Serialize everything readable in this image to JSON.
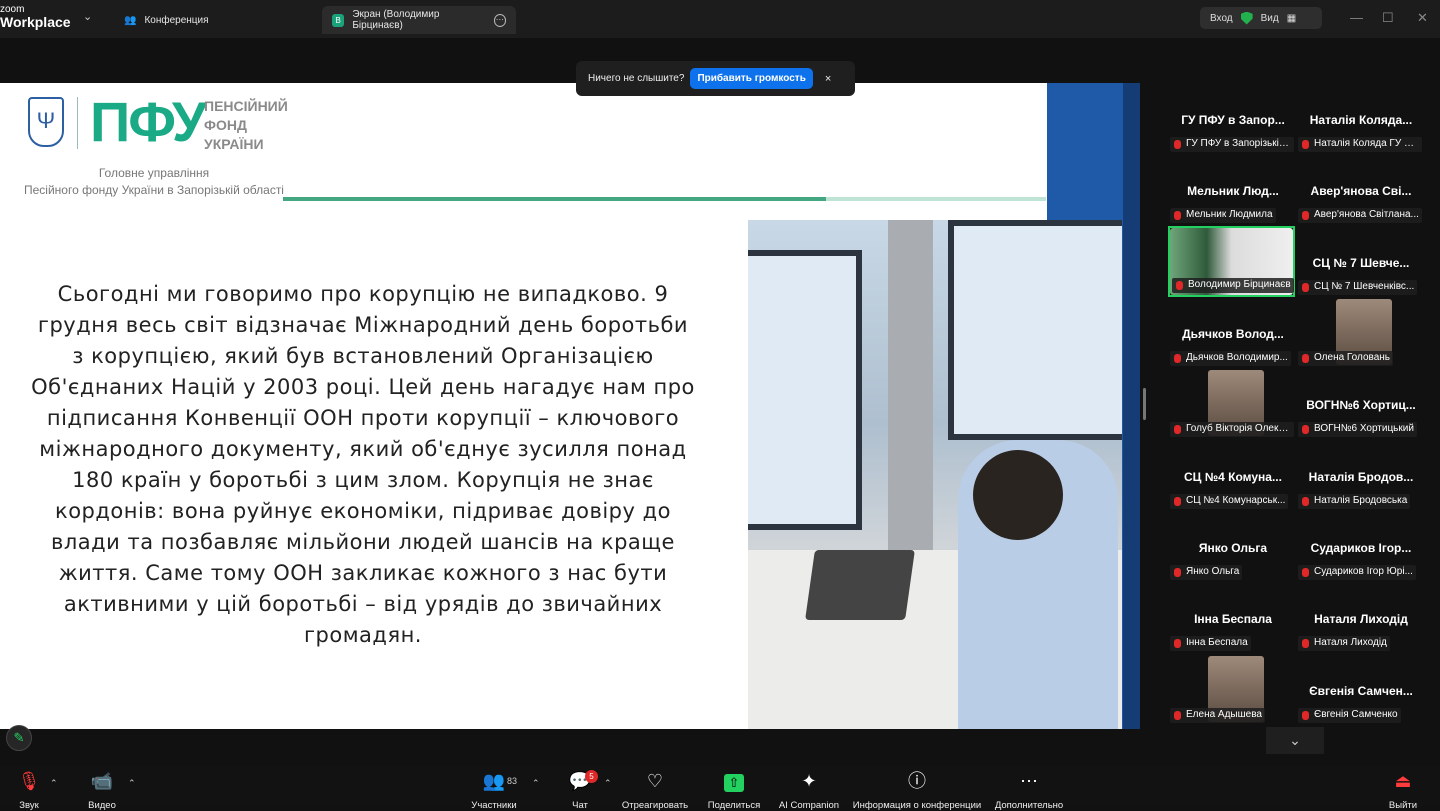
{
  "app": {
    "logo_top": "zoom",
    "logo_bottom": "Workplace"
  },
  "tabs": [
    {
      "label": "Конференция",
      "icon": "people-icon"
    },
    {
      "label": "Экран (Володимир Бірцинаєв)",
      "icon": "screen-icon",
      "avatar_letter": "В"
    }
  ],
  "header": {
    "signin_label": "Вход",
    "view_label": "Вид"
  },
  "notice": {
    "text": "Ничего не слышите?",
    "button_label": "Прибавить громкость",
    "close": "×"
  },
  "slide": {
    "emblem": "Ψ",
    "logo_text": "ПФУ",
    "logo_side": [
      "ПЕНСІЙНИЙ",
      "ФОНД",
      "УКРАЇНИ"
    ],
    "org": [
      "Головне управління",
      "Пеcійного фонду України в Запорізькій області"
    ],
    "body": "Сьогодні ми говоримо про корупцію не випадково. 9 грудня весь світ відзначає Міжнародний день боротьби з корупцією, який був встановлений Організацією Об'єднаних Націй у 2003 році. Цей день нагадує нам про підписання Конвенції ООН проти корупції – ключового міжнародного документу, який об'єднує зусилля понад 180 країн у боротьбі з цим злом. Корупція не знає кордонів: вона руйнує економіки, підриває довіру до влади та позбавляє мільйони людей шансів на краще життя. Саме тому ООН закликає кожного з нас бути активними у цій боротьбі – від урядів до звичайних громадян."
  },
  "participants": [
    {
      "name": "ГУ ПФУ в Запор...",
      "label": "ГУ ПФУ в Запорізькій ..."
    },
    {
      "name": "Наталія Коляда...",
      "label": "Наталія Коляда ГУ П..."
    },
    {
      "name": "Мельник Люд...",
      "label": "Мельник Людмила"
    },
    {
      "name": "Авер'янова Сві...",
      "label": "Авер'янова Світлана..."
    },
    {
      "name": "",
      "label": "Володимир Бірцинаєв"
    },
    {
      "name": "СЦ № 7 Шевче...",
      "label": "СЦ № 7 Шевченківс..."
    },
    {
      "name": "Дьячков Волод...",
      "label": "Дьячков Володимир..."
    },
    {
      "name": "",
      "label": "Олена Головань"
    },
    {
      "name": "",
      "label": "Голуб Вікторія Олекс..."
    },
    {
      "name": "ВОГН№6 Хортиц...",
      "label": "ВОГН№6 Хортицький"
    },
    {
      "name": "СЦ №4 Комуна...",
      "label": "СЦ №4 Комунарськ..."
    },
    {
      "name": "Наталія Бродов...",
      "label": "Наталія Бродовська"
    },
    {
      "name": "Янко Ольга",
      "label": "Янко Ольга"
    },
    {
      "name": "Судариков Ігор...",
      "label": "Судариков Ігор Юрі..."
    },
    {
      "name": "Інна Беспала",
      "label": "Інна Беспала"
    },
    {
      "name": "Наталя Лиходід",
      "label": "Наталя Лиходід"
    },
    {
      "name": "",
      "label": "Елена Адышева"
    },
    {
      "name": "Євгенія Самчен...",
      "label": "Євгенія Самченко"
    }
  ],
  "toolbar": {
    "audio": "Звук",
    "video": "Видео",
    "participants": "Участники",
    "participants_count": "83",
    "chat": "Чат",
    "chat_badge": "5",
    "react": "Отреагировать",
    "share": "Поделиться",
    "ai": "AI Companion",
    "info": "Информация о конференции",
    "more": "Дополнительно",
    "leave": "Выйти"
  },
  "colors": {
    "accent": "#0e72ed",
    "pfu_green": "#1aaa85",
    "active_border": "#23d160",
    "slide_blue": "#1f5aa8"
  }
}
